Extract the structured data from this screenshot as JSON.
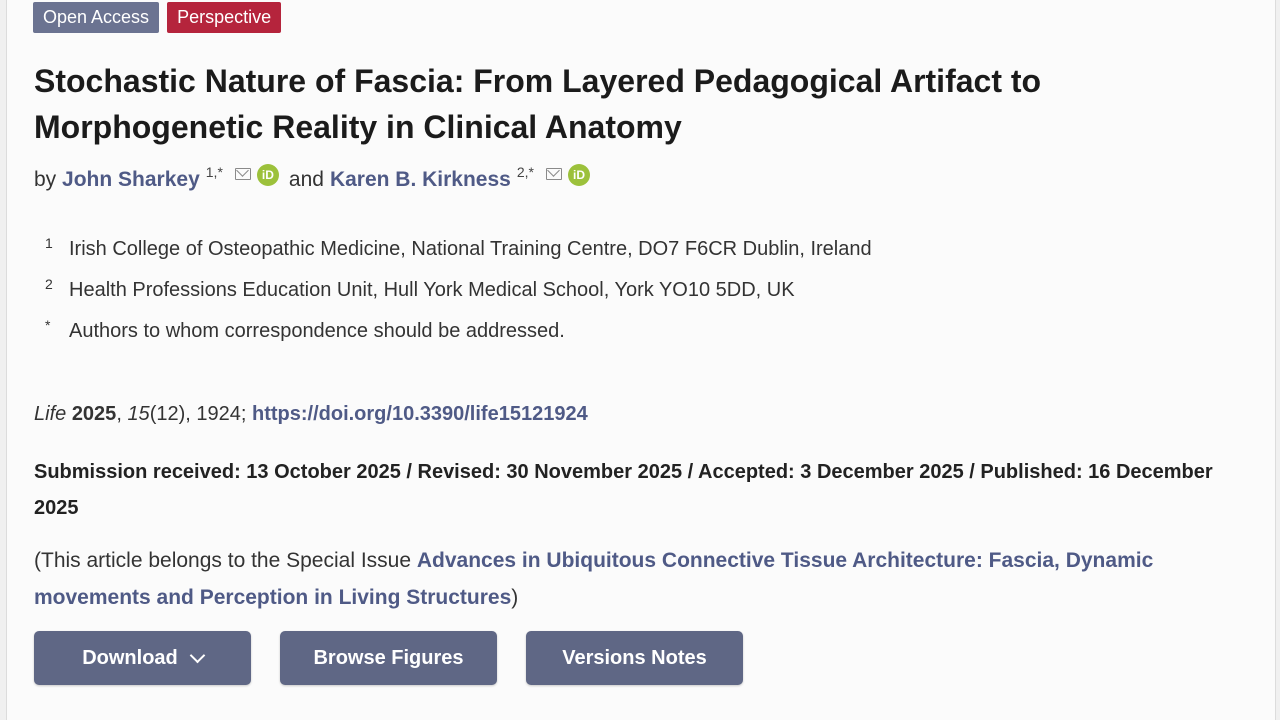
{
  "badges": {
    "open_access": "Open Access",
    "article_type": "Perspective"
  },
  "title": "Stochastic Nature of Fascia: From Layered Pedagogical Artifact to Morphogenetic Reality in Clinical Anatomy",
  "authors": {
    "by": "by",
    "and": "and",
    "list": [
      {
        "name": "John Sharkey",
        "sup": "1,*"
      },
      {
        "name": "Karen B. Kirkness",
        "sup": "2,*"
      }
    ]
  },
  "affiliations": [
    {
      "num": "1",
      "text": "Irish College of Osteopathic Medicine, National Training Centre, DO7 F6CR Dublin, Ireland"
    },
    {
      "num": "2",
      "text": "Health Professions Education Unit, Hull York Medical School, York YO10 5DD, UK"
    },
    {
      "num": "*",
      "text": "Authors to whom correspondence should be addressed."
    }
  ],
  "citation": {
    "journal": "Life",
    "year": "2025",
    "volume": "15",
    "issue": "(12), 1924;",
    "doi": "https://doi.org/10.3390/life15121924"
  },
  "dates": "Submission received: 13 October 2025 / Revised: 30 November 2025 / Accepted: 3 December 2025 / Published: 16 December 2025",
  "special_issue": {
    "prefix": "(This article belongs to the Special Issue ",
    "name": "Advances in Ubiquitous Connective Tissue Architecture: Fascia, Dynamic movements and Perception in Living Structures",
    "suffix": ")"
  },
  "buttons": {
    "download": "Download",
    "browse_figures": "Browse Figures",
    "versions_notes": "Versions Notes"
  },
  "colors": {
    "link": "#4f5a86",
    "button": "#5f6785",
    "badge_open_access": "#6b7391",
    "badge_type": "#b5243c",
    "orcid": "#9cc13b"
  }
}
